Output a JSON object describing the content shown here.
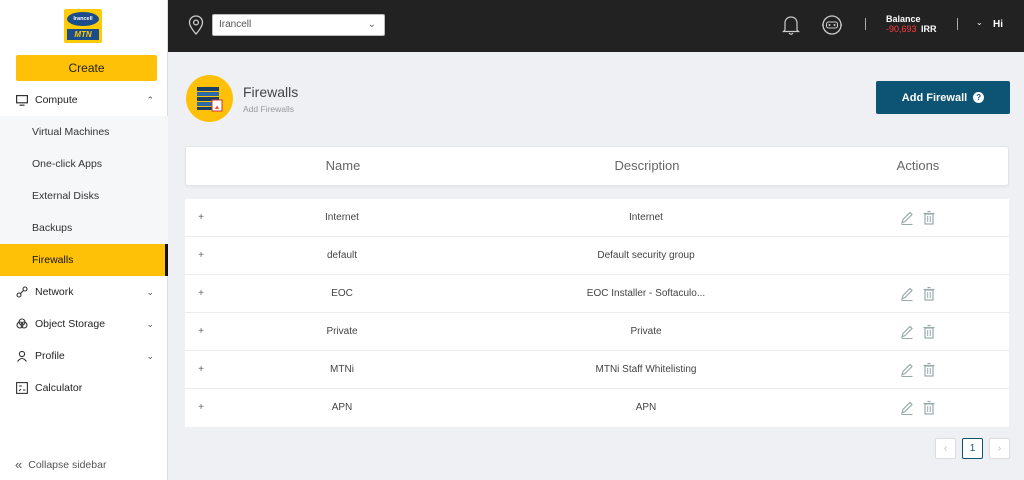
{
  "sidebar": {
    "create_label": "Create",
    "compute_label": "Compute",
    "sub_items": [
      {
        "label": "Virtual Machines",
        "active": false
      },
      {
        "label": "One-click Apps",
        "active": false
      },
      {
        "label": "External Disks",
        "active": false
      },
      {
        "label": "Backups",
        "active": false
      },
      {
        "label": "Firewalls",
        "active": true
      }
    ],
    "network_label": "Network",
    "object_storage_label": "Object Storage",
    "profile_label": "Profile",
    "calculator_label": "Calculator",
    "collapse_label": "Collapse sidebar"
  },
  "logo": {
    "top_text": "Irancell",
    "bottom_text": "MTN"
  },
  "topbar": {
    "region_value": "Irancell",
    "balance_label": "Balance",
    "balance_value": "-90,693",
    "balance_currency": "IRR",
    "user_greeting": "Hi"
  },
  "header": {
    "title": "Firewalls",
    "subtitle": "Add Firewalls",
    "add_button_label": "Add Firewall",
    "help_glyph": "?"
  },
  "table": {
    "columns": {
      "name": "Name",
      "description": "Description",
      "actions": "Actions"
    },
    "rows": [
      {
        "name": "Internet",
        "description": "Internet",
        "editable": true
      },
      {
        "name": "default",
        "description": "Default security group",
        "editable": false
      },
      {
        "name": "EOC",
        "description": "EOC Installer - Softaculo...",
        "editable": true
      },
      {
        "name": "Private",
        "description": "Private",
        "editable": true
      },
      {
        "name": "MTNi",
        "description": "MTNi Staff Whitelisting",
        "editable": true
      },
      {
        "name": "APN",
        "description": "APN",
        "editable": true
      }
    ]
  },
  "pagination": {
    "prev": "‹",
    "current": "1",
    "next": "›"
  },
  "colors": {
    "accent": "#ffc107",
    "primary": "#0c5374",
    "topbar": "#222222",
    "negative": "#ff3b3b"
  }
}
